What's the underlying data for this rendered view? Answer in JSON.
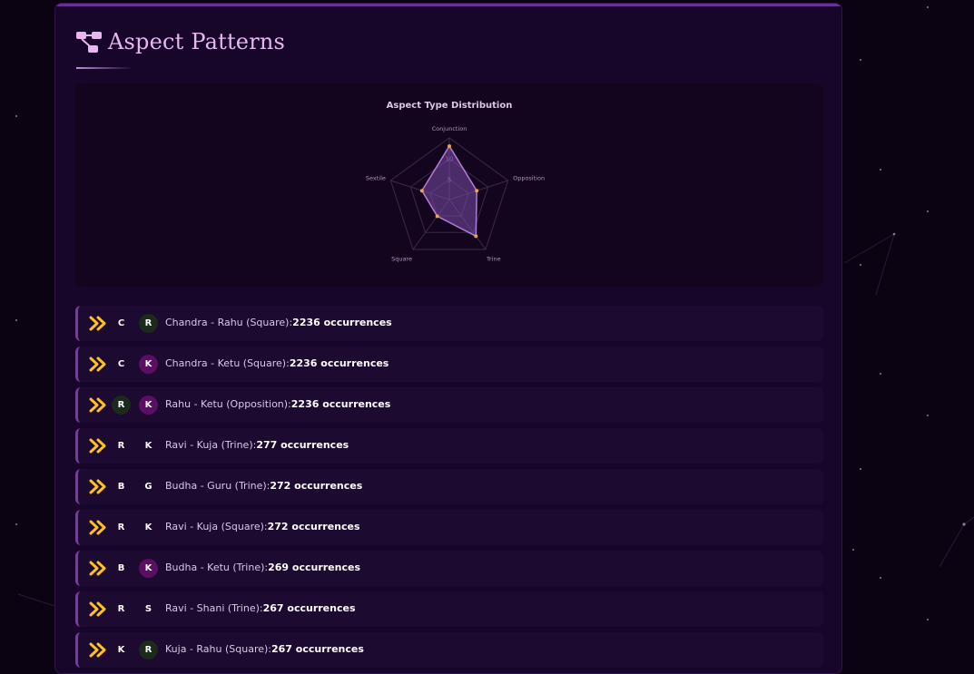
{
  "page": {
    "title": "Aspect Patterns",
    "title_icon": "network-nodes-icon"
  },
  "chart_data": {
    "type": "radar",
    "title": "Aspect Type Distribution",
    "axes": [
      "Conjunction",
      "Opposition",
      "Trine",
      "Square",
      "Sextile"
    ],
    "values": [
      13,
      7,
      11,
      5,
      7
    ],
    "radial_ticks": [
      5,
      10
    ],
    "rmax": 15,
    "grid": true,
    "colors": {
      "fill": "#7a4aa6",
      "stroke": "#b27cd6",
      "point": "#f2a23a",
      "grid": "#3a2a4a"
    }
  },
  "aspects": [
    {
      "p1": "C",
      "p1_style": "plain",
      "p2": "R",
      "p2_style": "green",
      "label": "Chandra - Rahu (Square):",
      "count": "2236 occurrences"
    },
    {
      "p1": "C",
      "p1_style": "plain",
      "p2": "K",
      "p2_style": "purple",
      "label": "Chandra - Ketu (Square):",
      "count": "2236 occurrences"
    },
    {
      "p1": "R",
      "p1_style": "green",
      "p2": "K",
      "p2_style": "purple",
      "label": "Rahu - Ketu (Opposition):",
      "count": "2236 occurrences"
    },
    {
      "p1": "R",
      "p1_style": "plain",
      "p2": "K",
      "p2_style": "plain",
      "label": "Ravi - Kuja (Trine):",
      "count": "277 occurrences"
    },
    {
      "p1": "B",
      "p1_style": "plain",
      "p2": "G",
      "p2_style": "plain",
      "label": "Budha - Guru (Trine):",
      "count": "272 occurrences"
    },
    {
      "p1": "R",
      "p1_style": "plain",
      "p2": "K",
      "p2_style": "plain",
      "label": "Ravi - Kuja (Square):",
      "count": "272 occurrences"
    },
    {
      "p1": "B",
      "p1_style": "plain",
      "p2": "K",
      "p2_style": "purple",
      "label": "Budha - Ketu (Trine):",
      "count": "269 occurrences"
    },
    {
      "p1": "R",
      "p1_style": "plain",
      "p2": "S",
      "p2_style": "plain",
      "label": "Ravi - Shani (Trine):",
      "count": "267 occurrences"
    },
    {
      "p1": "K",
      "p1_style": "plain",
      "p2": "R",
      "p2_style": "green",
      "label": "Kuja - Rahu (Square):",
      "count": "267 occurrences"
    }
  ],
  "badge_colors": {
    "plain": "transparent",
    "green": "#1b2a1a",
    "purple": "#5a0f63"
  },
  "accent": "#ffc21a"
}
